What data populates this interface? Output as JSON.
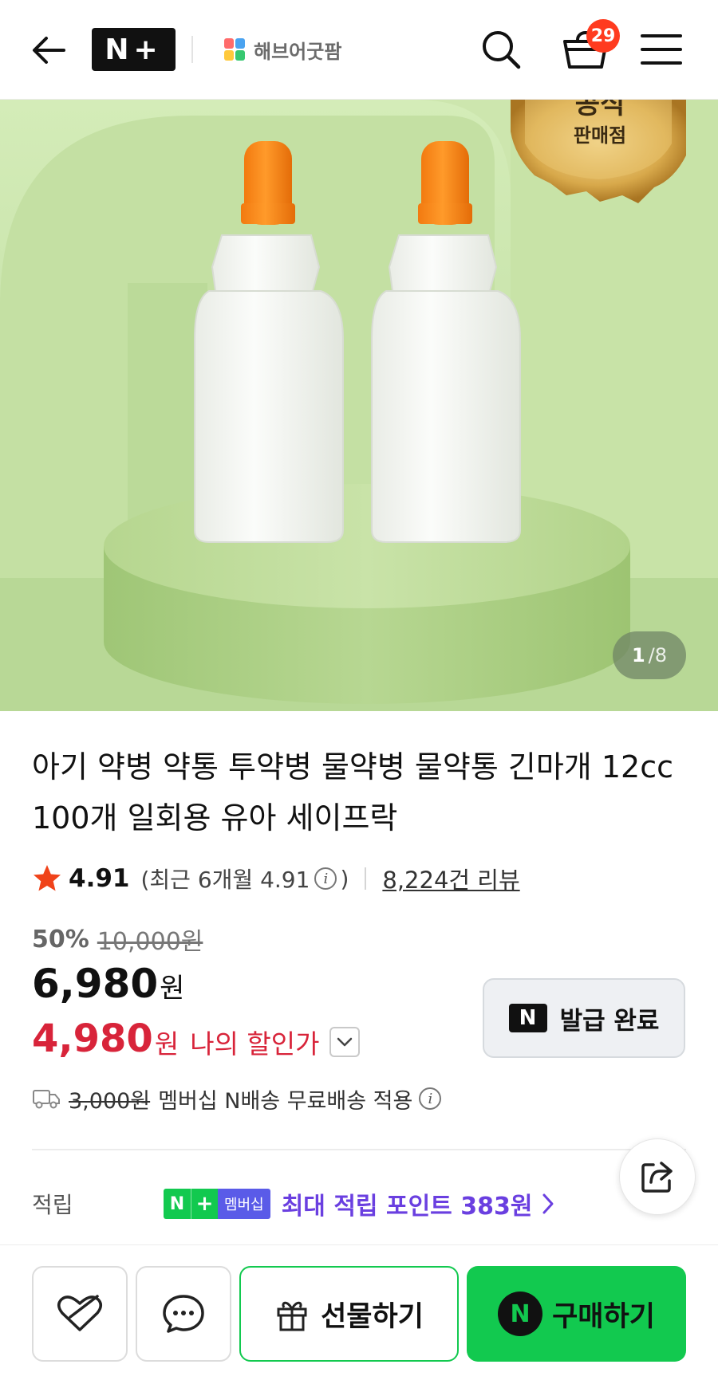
{
  "header": {
    "logo_text": "N+",
    "store_name": "해브어굿팜",
    "cart_count": "29",
    "icons": [
      "back-arrow-icon",
      "search-icon",
      "cart-icon",
      "hamburger-menu-icon"
    ]
  },
  "hero": {
    "badge_text_top": "공식",
    "badge_text": "판매점",
    "current_page": "1",
    "total_pages": "/8"
  },
  "product": {
    "title": "아기 약병 약통 투약병 물약병 물약통 긴마개 12cc 100개 일회용 유아 세이프락",
    "rating": "4.91",
    "recent_rating": "(최근 6개월 4.91",
    "recent_rating_close": ")",
    "review_count": "8,224건 리뷰",
    "discount_rate": "50%",
    "original_price": "10,000원",
    "price": "6,980",
    "price_unit": "원",
    "my_price": "4,980",
    "my_price_unit": "원",
    "my_price_label": "나의 할인가"
  },
  "coupon": {
    "icon_text": "N",
    "label": "발급 완료"
  },
  "shipping": {
    "fee": "3,000원",
    "desc": "멤버십 N배송 무료배송 적용"
  },
  "points": {
    "label": "적립",
    "badge_n": "N",
    "badge_plus": "+",
    "badge_text": "멤버십",
    "text": "최대 적립 포인트 383원"
  },
  "bottom": {
    "gift_label": "선물하기",
    "buy_icon": "N",
    "buy_label": "구매하기"
  },
  "colors": {
    "accent_green": "#12c94f",
    "sale_red": "#d8243a",
    "points_purple": "#6a3fe0",
    "badge_red": "#ff3b1f"
  }
}
